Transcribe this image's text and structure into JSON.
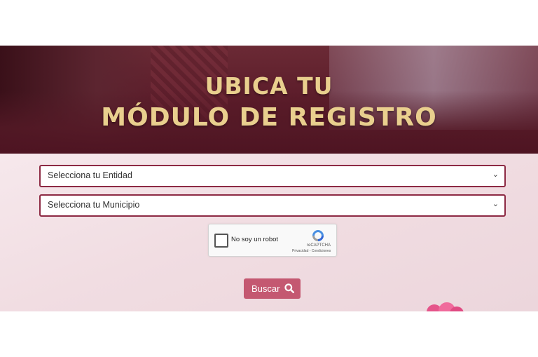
{
  "hero": {
    "title_line1": "UBICA TU",
    "title_line2": "MÓDULO DE REGISTRO"
  },
  "form": {
    "entity_select": {
      "label": "Selecciona tu Entidad"
    },
    "municipality_select": {
      "label": "Selecciona tu Municipio"
    },
    "chevron": "⌄"
  },
  "captcha": {
    "label": "No soy un robot",
    "brand": "reCAPTCHA",
    "links": "Privacidad - Condiciones"
  },
  "search_button": {
    "label": "Buscar",
    "icon": "search-icon"
  },
  "colors": {
    "hero_bg": "#5a1b29",
    "title_gold": "#e9cf8e",
    "select_border": "#8d2a44",
    "button_bg": "#c45871",
    "form_bg": "#f1dde2"
  }
}
